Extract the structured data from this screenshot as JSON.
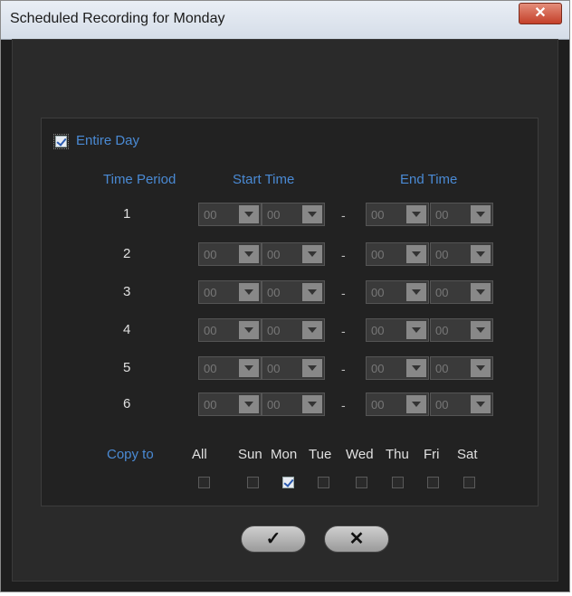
{
  "window": {
    "title": "Scheduled Recording for Monday",
    "close_icon": "x",
    "accent": "#4a8ad4"
  },
  "entire_day": {
    "label": "Entire Day",
    "checked": true
  },
  "headers": {
    "time_period": "Time Period",
    "start_time": "Start Time",
    "end_time": "End Time"
  },
  "periods": [
    {
      "num": "1",
      "sh": "00",
      "sm": "00",
      "eh": "00",
      "em": "00"
    },
    {
      "num": "2",
      "sh": "00",
      "sm": "00",
      "eh": "00",
      "em": "00"
    },
    {
      "num": "3",
      "sh": "00",
      "sm": "00",
      "eh": "00",
      "em": "00"
    },
    {
      "num": "4",
      "sh": "00",
      "sm": "00",
      "eh": "00",
      "em": "00"
    },
    {
      "num": "5",
      "sh": "00",
      "sm": "00",
      "eh": "00",
      "em": "00"
    },
    {
      "num": "6",
      "sh": "00",
      "sm": "00",
      "eh": "00",
      "em": "00"
    }
  ],
  "separator": "-",
  "copy_to": {
    "label": "Copy to",
    "days": [
      {
        "label": "All",
        "checked": false
      },
      {
        "label": "Sun",
        "checked": false
      },
      {
        "label": "Mon",
        "checked": true
      },
      {
        "label": "Tue",
        "checked": false
      },
      {
        "label": "Wed",
        "checked": false
      },
      {
        "label": "Thu",
        "checked": false
      },
      {
        "label": "Fri",
        "checked": false
      },
      {
        "label": "Sat",
        "checked": false
      }
    ]
  },
  "buttons": {
    "ok_icon": "checkmark-icon",
    "cancel_icon": "x-icon",
    "ok_glyph": "✓",
    "cancel_glyph": "✕"
  }
}
